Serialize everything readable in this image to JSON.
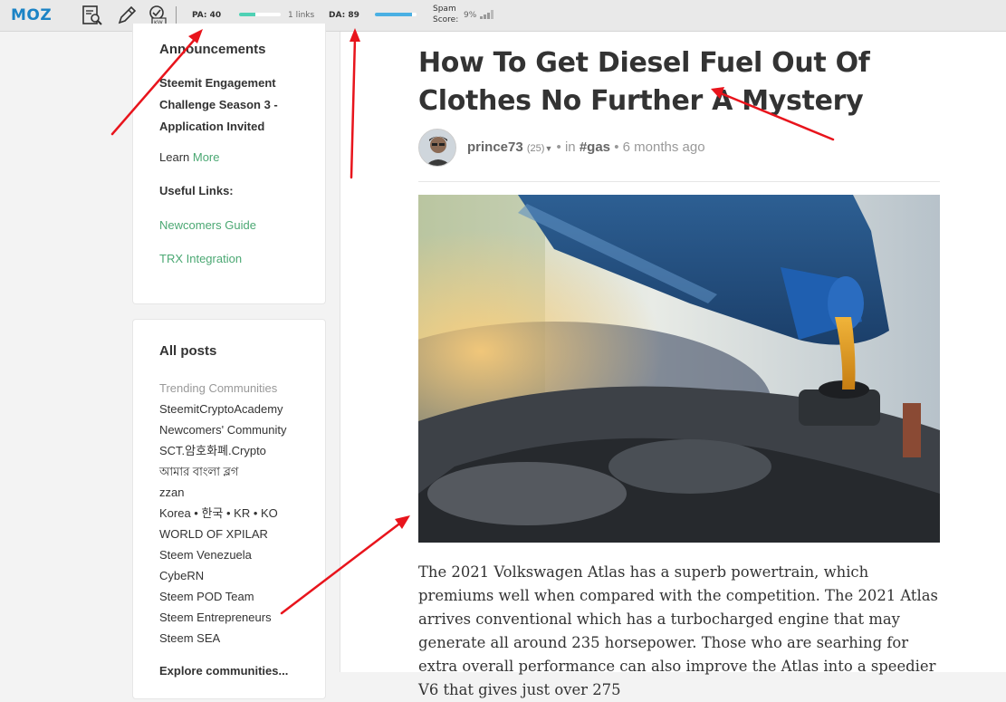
{
  "mozbar": {
    "logo": "MOZ",
    "pa_label": "PA: 40",
    "pa_score": 40,
    "links_label": "1 links",
    "da_label": "DA: 89",
    "da_score": 89,
    "spam_label_line1": "Spam",
    "spam_label_line2": "Score:",
    "spam_value": "9%",
    "icons": [
      "page-analysis-icon",
      "highlight-pencil-icon",
      "keyword-icon"
    ]
  },
  "sidebar": {
    "announcements": {
      "heading": "Announcements",
      "text": "Steemit Engagement Challenge Season 3 - Application Invited",
      "learn_prefix": "Learn",
      "learn_link": "More",
      "useful_heading": "Useful Links:",
      "links": [
        "Newcomers Guide",
        "TRX Integration"
      ]
    },
    "all_posts": {
      "heading": "All posts",
      "items": [
        "Trending Communities",
        "SteemitCryptoAcademy",
        "Newcomers' Community",
        "SCT.암호화폐.Crypto",
        "আমার বাংলা ব্লগ",
        "zzan",
        "Korea • 한국 • KR • KO",
        "WORLD OF XPILAR",
        "Steem Venezuela",
        "CybeRN",
        "Steem POD Team",
        "Steem Entrepreneurs",
        "Steem SEA"
      ],
      "explore": "Explore communities..."
    }
  },
  "post": {
    "title": "How To Get Diesel Fuel Out Of Clothes No Further A Mystery",
    "author": "prince73",
    "reputation": "(25)",
    "in_word": "in",
    "tag": "#gas",
    "separator": "•",
    "time": "6 months ago",
    "body": "The 2021 Volkswagen Atlas has a superb powertrain, which premiums well when compared with the competition. The 2021 Atlas arrives conventional which has a turbocharged engine that may generate all around 235 horsepower. Those who are searhing for extra overall performance can also improve the Atlas into a speedier V6 that gives just over 275"
  },
  "colors": {
    "moz_blue": "#1b83c5",
    "pa_bar": "#4fd1b4",
    "da_bar": "#4ab0e3",
    "link_green": "#4ba873",
    "annotation_arrow": "#e8141c"
  }
}
